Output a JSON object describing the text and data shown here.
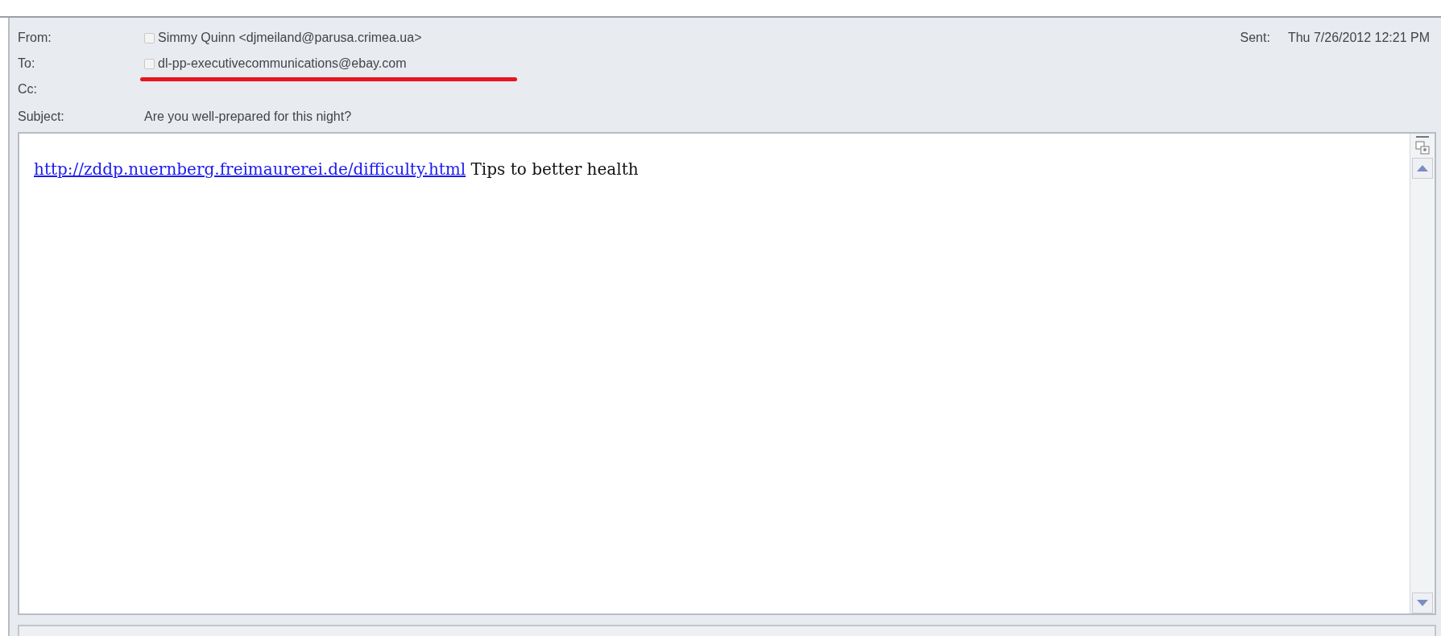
{
  "header": {
    "fields": [
      {
        "label": "From:",
        "value": "Simmy Quinn <djmeiland@parusa.crimea.ua>",
        "kind": "contact"
      },
      {
        "label": "To:",
        "value": "dl-pp-executivecommunications@ebay.com",
        "kind": "contact",
        "underlined": true
      },
      {
        "label": "Cc:",
        "kind": "contact"
      },
      {
        "label": "Subject:",
        "value": "Are you well-prepared for this night?",
        "kind": "text"
      }
    ],
    "sent": {
      "label": "Sent:",
      "value": "Thu 7/26/2012 12:21 PM"
    }
  },
  "body": {
    "link": "http://zddp.nuernberg.freimaurerei.de/difficulty.html",
    "text": "Tips to better health"
  }
}
